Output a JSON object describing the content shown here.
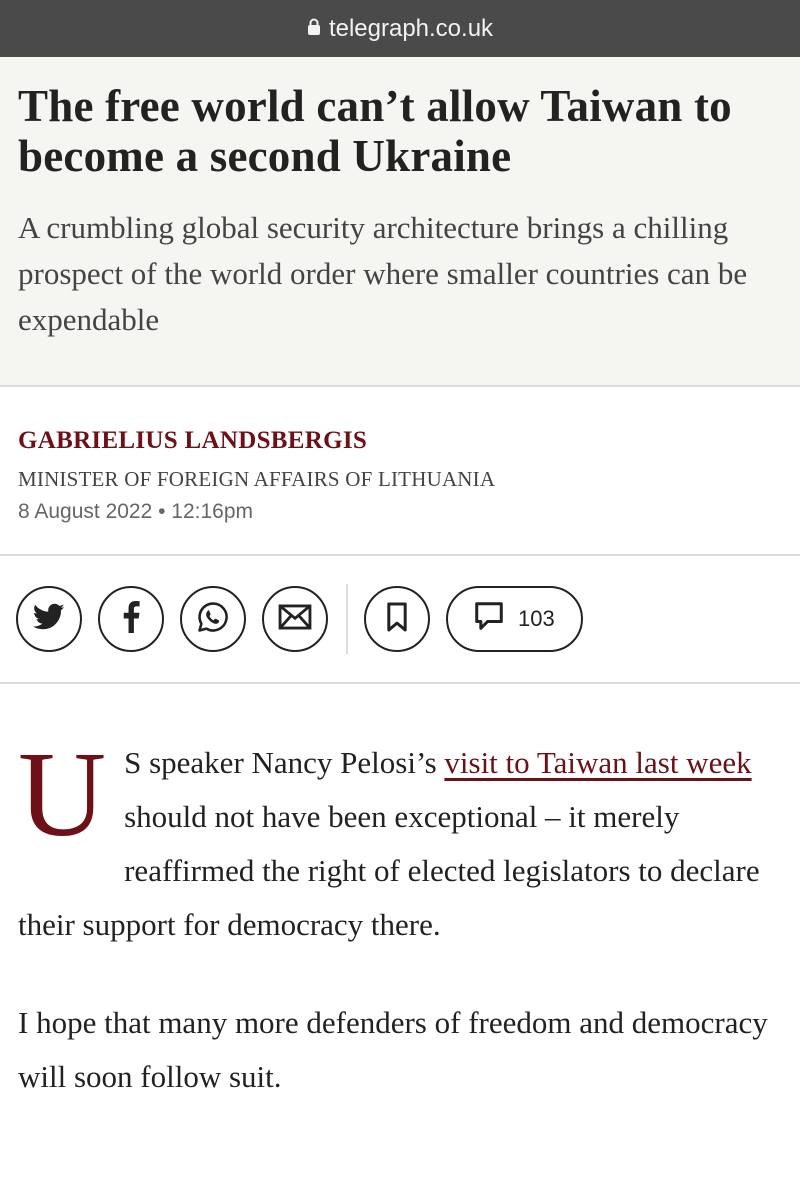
{
  "browser": {
    "url": "telegraph.co.uk",
    "lock_icon": "lock-icon"
  },
  "article": {
    "headline": "The free world can’t allow Taiwan to become a second Ukraine",
    "standfirst": "A crumbling global security architecture brings a chilling prospect of the world order where smaller countries can be expendable",
    "author": "GABRIELIUS LANDSBERGIS",
    "author_role": "MINISTER OF FOREIGN AFFAIRS OF LITHUANIA",
    "date": "8 August 2022 • 12:16pm",
    "share": {
      "icons": [
        "twitter-icon",
        "facebook-icon",
        "whatsapp-icon",
        "email-icon",
        "bookmark-icon",
        "comment-icon"
      ],
      "comment_count": "103"
    },
    "body": {
      "dropcap": "U",
      "p1_before": "S speaker Nancy Pelosi’s ",
      "p1_link": "visit to Taiwan last week",
      "p1_after": " should not have been exceptional – it merely reaffirmed the right of elected legislators to declare their support for democracy there.",
      "p2": "I hope that many more defenders of freedom and democracy will soon follow suit."
    }
  },
  "colors": {
    "accent": "#6d1017",
    "header_bg": "#f5f5f2",
    "urlbar_bg": "#4a4a4a"
  }
}
